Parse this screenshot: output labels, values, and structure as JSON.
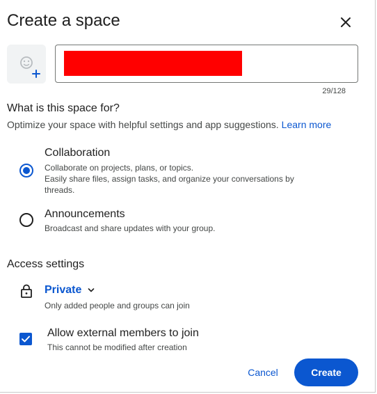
{
  "dialog": {
    "title": "Create a space",
    "close_icon": "close-icon"
  },
  "space_name": {
    "value": "",
    "redacted": true,
    "counter": "29/128"
  },
  "emoji_picker": {
    "icon": "add-emoji-icon"
  },
  "purpose": {
    "heading": "What is this space for?",
    "subtext": "Optimize your space with helpful settings and app suggestions.",
    "learn_more": "Learn more",
    "options": [
      {
        "title": "Collaboration",
        "desc1": "Collaborate on projects, plans, or topics.",
        "desc2": "Easily share files, assign tasks, and organize your conversations by threads.",
        "selected": true
      },
      {
        "title": "Announcements",
        "desc1": "Broadcast and share updates with your group.",
        "selected": false
      }
    ]
  },
  "access": {
    "heading": "Access settings",
    "privacy_label": "Private",
    "privacy_desc": "Only added people and groups can join",
    "lock_icon": "lock-icon",
    "external": {
      "label": "Allow external members to join",
      "desc": "This cannot be modified after creation",
      "checked": true
    }
  },
  "actions": {
    "cancel": "Cancel",
    "create": "Create"
  },
  "colors": {
    "accent": "#0b57d0",
    "text": "#1f1f1f",
    "subtext": "#444746",
    "redaction": "#ff0000"
  }
}
